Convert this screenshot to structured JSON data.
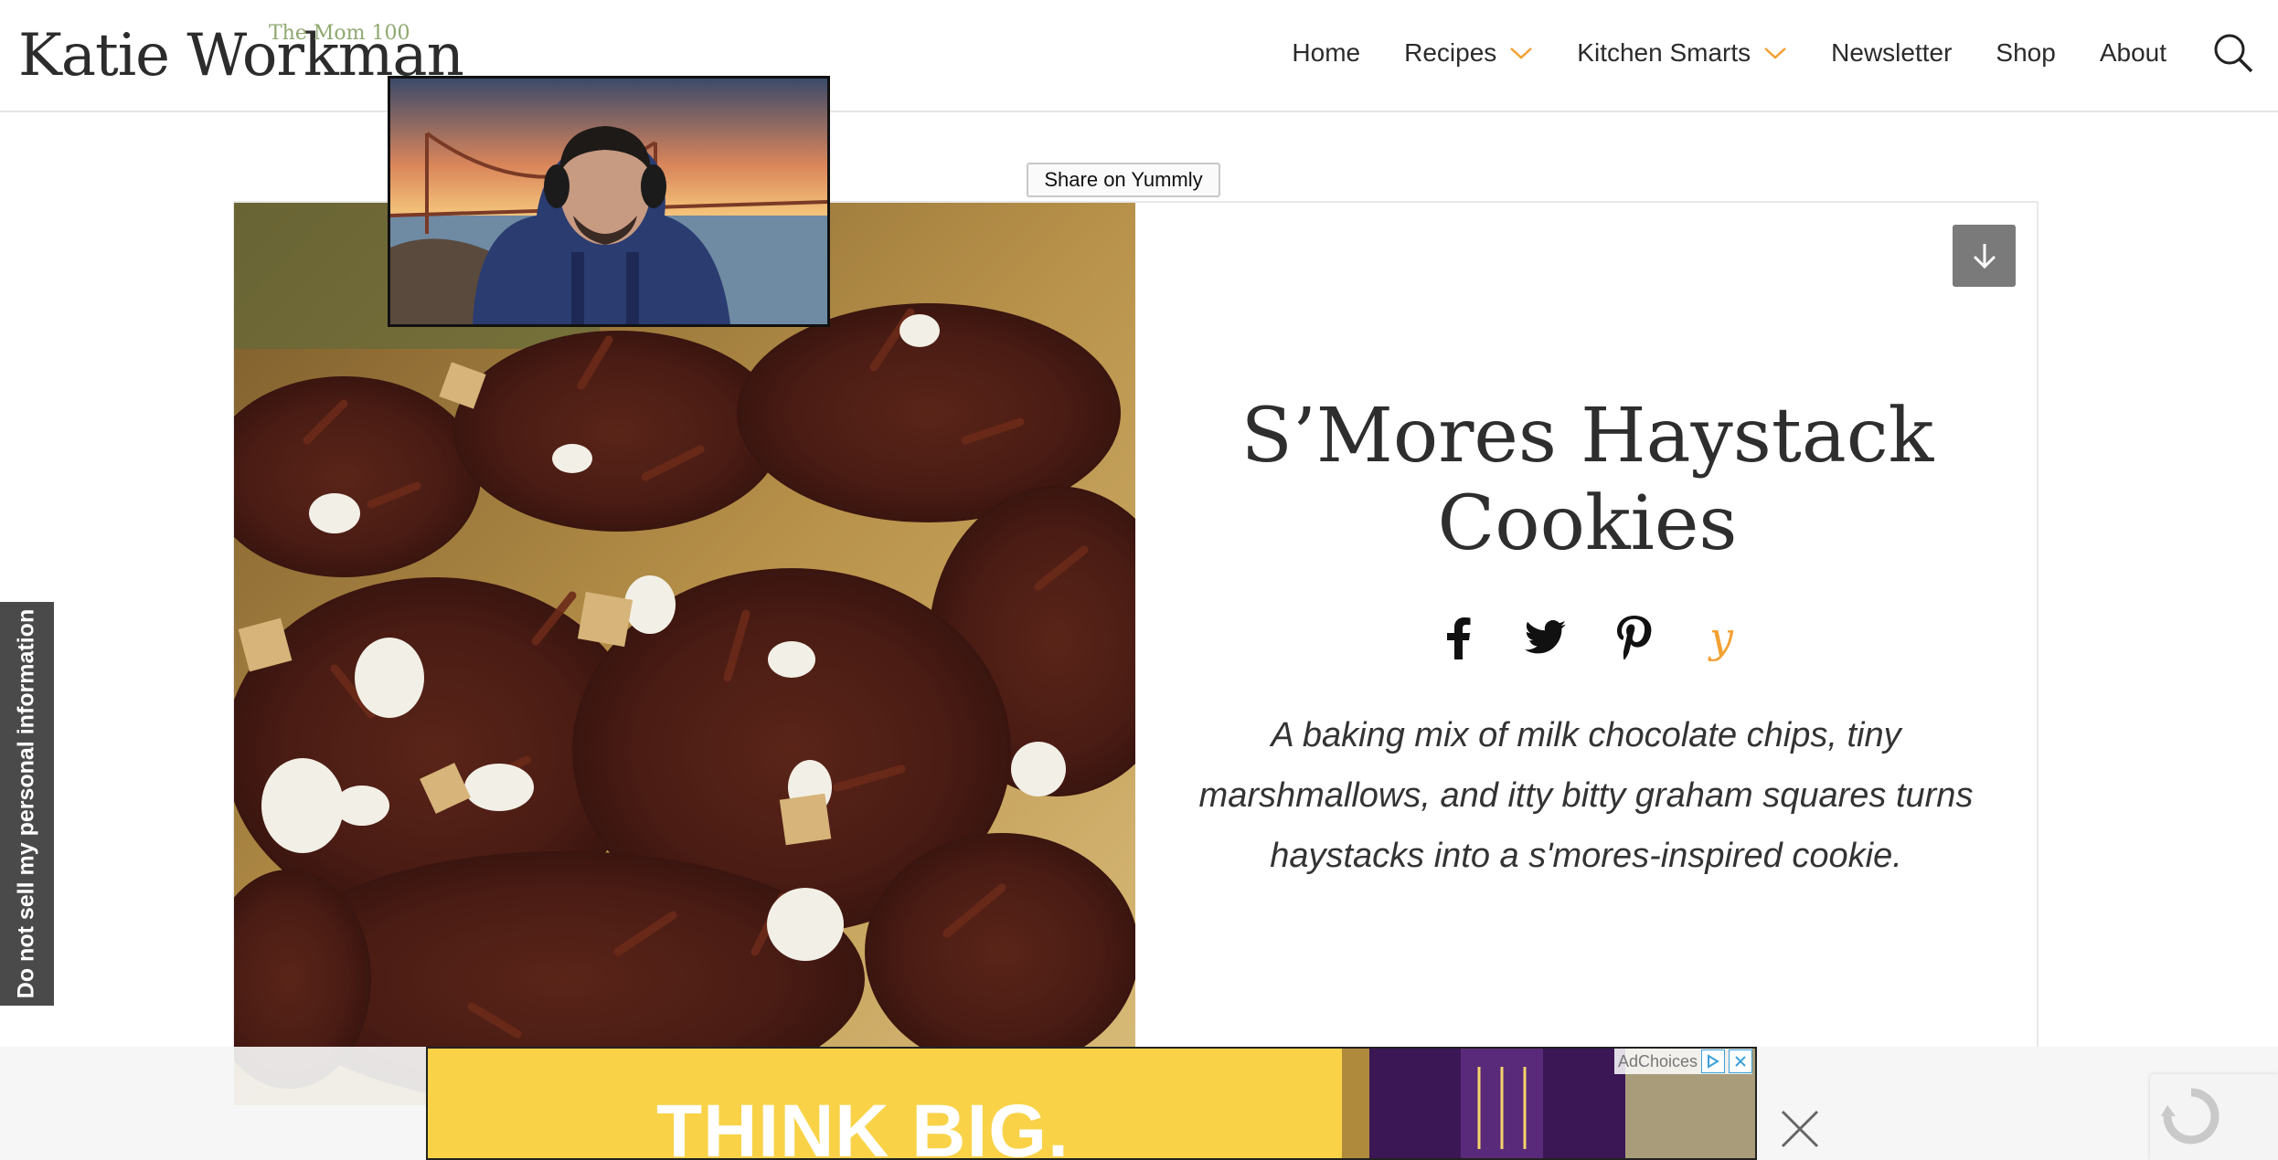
{
  "site": {
    "logo_name": "Katie Workman",
    "logo_tagline": "The Mom 100"
  },
  "nav": {
    "items": [
      {
        "label": "Home",
        "dropdown": false
      },
      {
        "label": "Recipes",
        "dropdown": true
      },
      {
        "label": "Kitchen Smarts",
        "dropdown": true
      },
      {
        "label": "Newsletter",
        "dropdown": false
      },
      {
        "label": "Shop",
        "dropdown": false
      },
      {
        "label": "About",
        "dropdown": false
      }
    ],
    "search_icon": "search-icon"
  },
  "privacy_tab": {
    "label": "Do not sell my personal information"
  },
  "share_on_yummly": {
    "label": "Share on Yummly"
  },
  "recipe": {
    "title_line1": "S’Mores Haystack",
    "title_line2": "Cookies",
    "summary": "A baking mix of milk chocolate chips, tiny marshmallows, and itty bitty graham squares turns haystacks into a s'mores-inspired cookie.",
    "share_icons": [
      "facebook-icon",
      "twitter-icon",
      "pinterest-icon",
      "yummly-icon"
    ],
    "yummly_glyph": "y",
    "jump_icon": "arrow-down-icon"
  },
  "ad": {
    "headline": "THINK BIG.",
    "choices_label": "AdChoices",
    "colors": {
      "yellow": "#f9d247",
      "purple": "#4b1f6b"
    }
  },
  "colors": {
    "logo_tagline": "#8fa870",
    "nav_chevron": "#f2a033",
    "yummly": "#f2a033",
    "jump_button": "#7a7a7a"
  }
}
